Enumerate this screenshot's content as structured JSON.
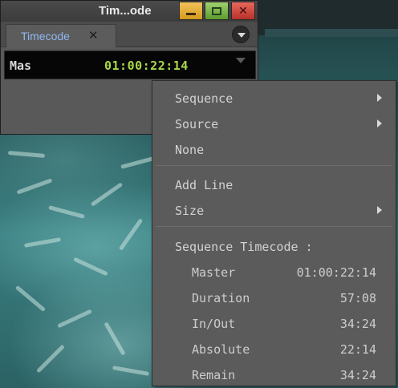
{
  "window": {
    "title": "Tim...ode",
    "minimize_icon": "minimize-icon",
    "maximize_icon": "maximize-icon",
    "close_glyph": "✕"
  },
  "tab": {
    "label": "Timecode",
    "close_glyph": "✕"
  },
  "display": {
    "label": "Mas",
    "value": "01:00:22:14",
    "value_color": "#a8d94a"
  },
  "menu": {
    "items": [
      {
        "label": "Sequence",
        "submenu": true
      },
      {
        "label": "Source",
        "submenu": true
      },
      {
        "label": "None",
        "submenu": false
      },
      {
        "label": "Add Line",
        "submenu": false
      },
      {
        "label": "Size",
        "submenu": true
      }
    ],
    "section_header": "Sequence Timecode :",
    "rows": [
      {
        "label": "Master",
        "value": "01:00:22:14"
      },
      {
        "label": "Duration",
        "value": "57:08"
      },
      {
        "label": "In/Out",
        "value": "34:24"
      },
      {
        "label": "Absolute",
        "value": "22:14"
      },
      {
        "label": "Remain",
        "value": "34:24"
      }
    ]
  }
}
